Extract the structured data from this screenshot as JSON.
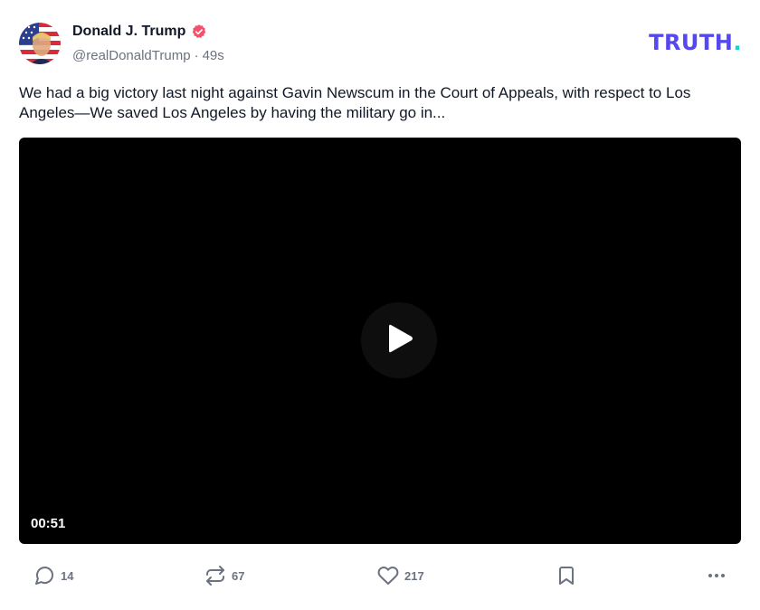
{
  "post": {
    "author": {
      "display_name": "Donald J. Trump",
      "handle": "@realDonaldTrump",
      "time_ago": "49s",
      "separator": "·",
      "verified": true,
      "verified_color": "#f4506c"
    },
    "brand": {
      "logo_text": "TRUTH",
      "logo_dot": ".",
      "logo_color": "#5448ee",
      "dot_color": "#0fd8c6"
    },
    "text": "We had a big victory last night against Gavin Newscum in the Court of Appeals, with respect to Los Angeles—We saved Los Angeles by having the military go in...",
    "video": {
      "duration": "00:51",
      "icon": "play-icon"
    },
    "actions": {
      "replies": {
        "icon": "comment-icon",
        "count": "14"
      },
      "retruths": {
        "icon": "retruth-icon",
        "count": "67"
      },
      "likes": {
        "icon": "heart-icon",
        "count": "217"
      },
      "bookmark": {
        "icon": "bookmark-icon"
      },
      "more": {
        "icon": "more-icon"
      }
    }
  }
}
